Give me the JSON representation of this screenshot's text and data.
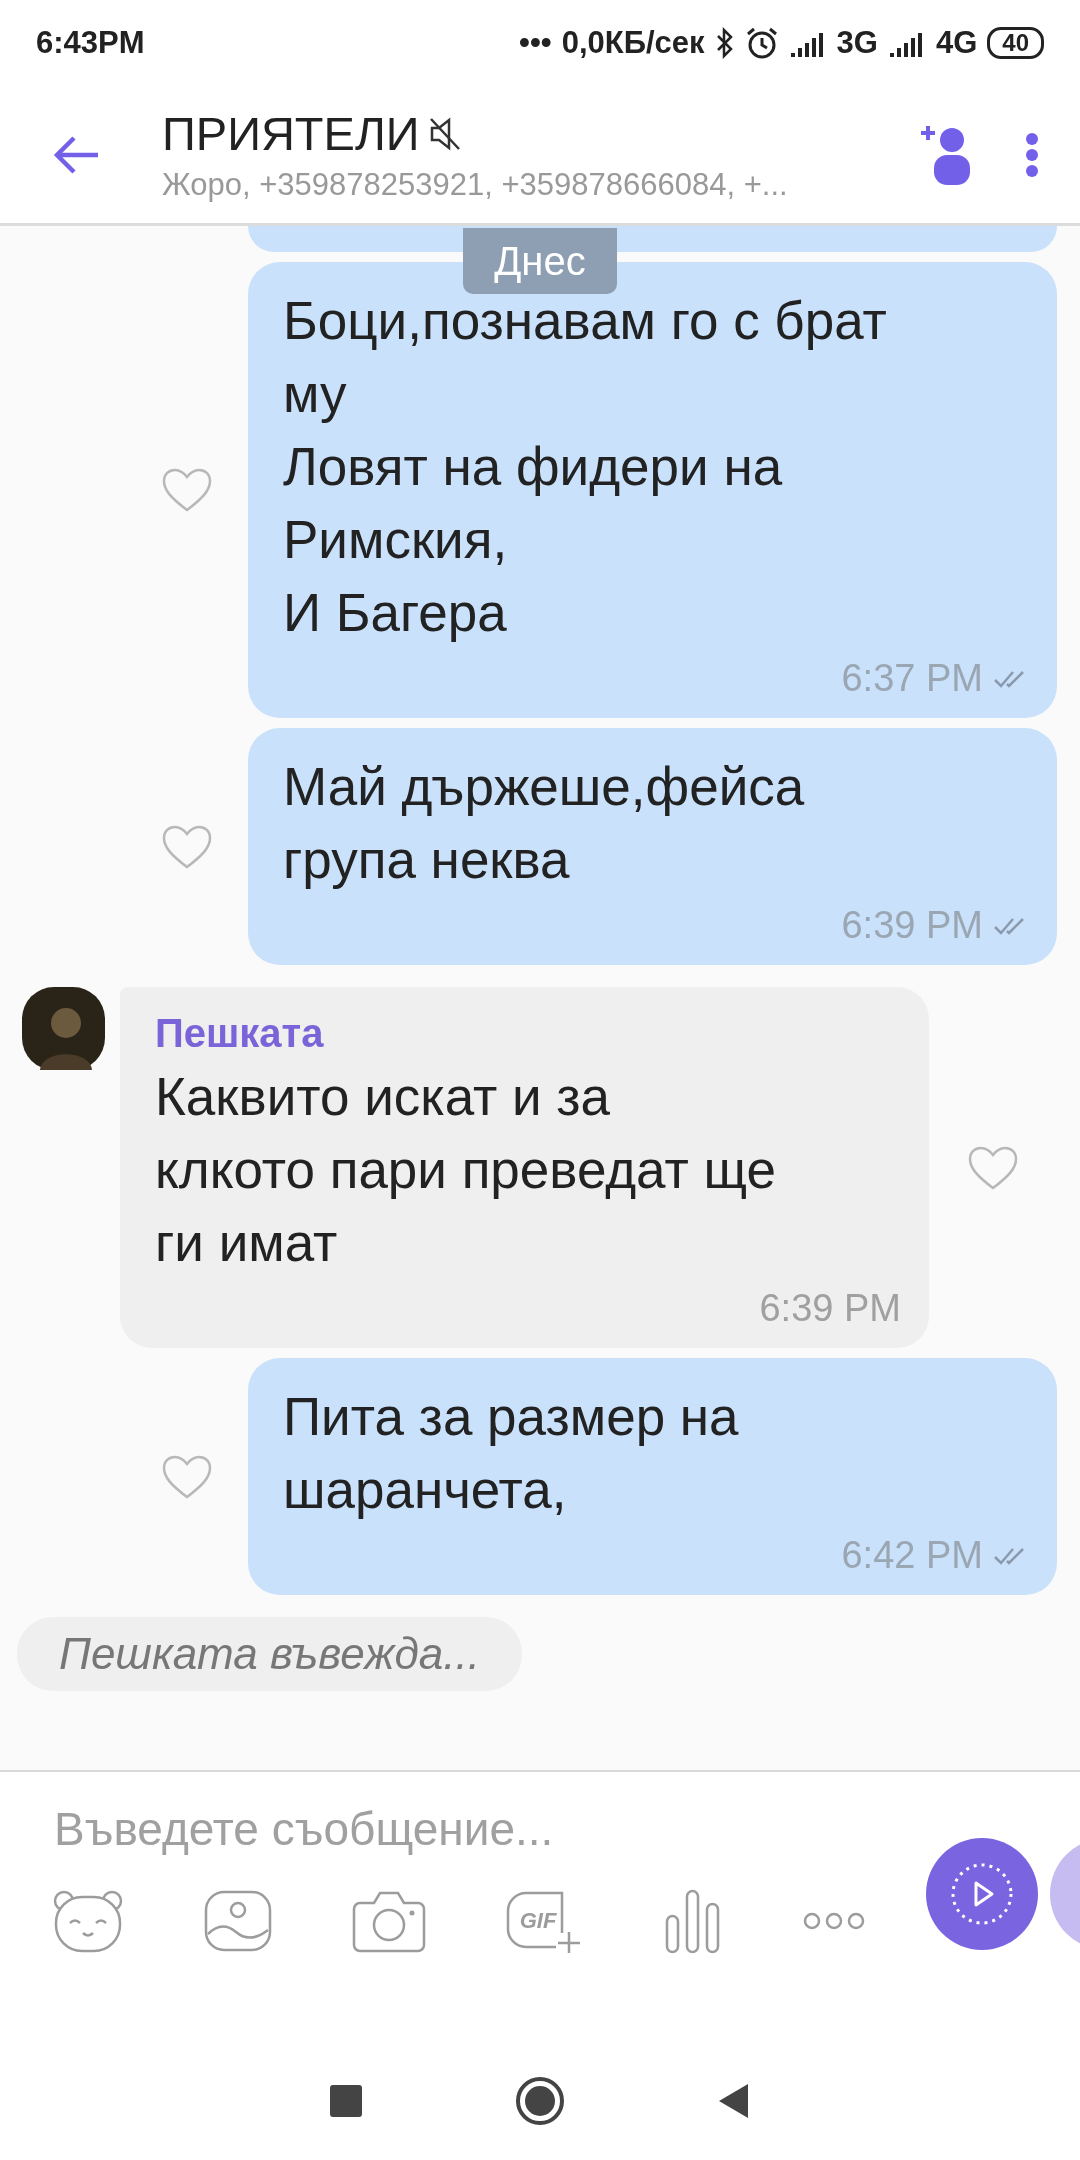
{
  "status_bar": {
    "time": "6:43PM",
    "dots": "•••",
    "speed": "0,0КБ/сек",
    "network_1": "3G",
    "network_2": "4G",
    "battery": "40"
  },
  "header": {
    "title": "ПРИЯТЕЛИ",
    "muted": true,
    "subtitle": "Жоро, +359878253921, +359878666084, +..."
  },
  "date_badge": "Днес",
  "messages": [
    {
      "kind": "outgoing",
      "text": "Боци,познавам го с брат\nму\nЛовят на фидери на\nРимския,\nИ Багера",
      "time": "6:37 PM"
    },
    {
      "kind": "outgoing",
      "text": "Май държеше,фейса\nгрупа неква",
      "time": "6:39 PM"
    },
    {
      "kind": "incoming",
      "sender": "Пешката",
      "text": "Каквито искат и за\nклкото пари преведат ще\nги имат",
      "time": "6:39 PM"
    },
    {
      "kind": "outgoing",
      "text": "Пита за размер на\nшаранчета,",
      "time": "6:42 PM"
    }
  ],
  "typing_indicator": "Пешката въвежда...",
  "composer": {
    "placeholder": "Въведете съобщение...",
    "gif_label": "GIF"
  }
}
